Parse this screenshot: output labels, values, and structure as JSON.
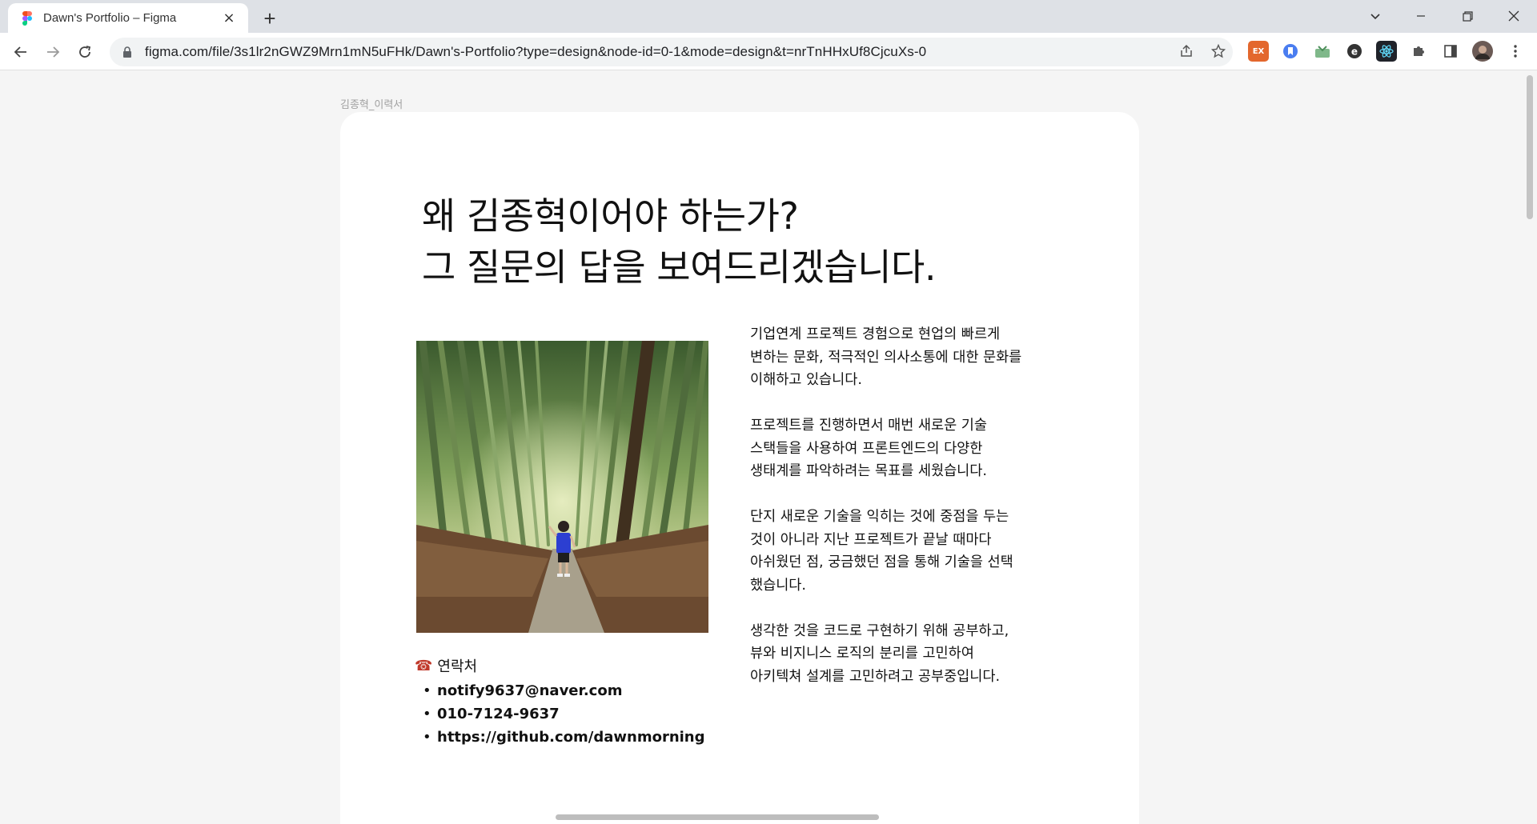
{
  "browser": {
    "tab_title": "Dawn's Portfolio – Figma",
    "url": "figma.com/file/3s1lr2nGWZ9Mrn1mN5uFHk/Dawn's-Portfolio?type=design&node-id=0-1&mode=design&t=nrTnHHxUf8CjcuXs-0",
    "new_tab_label": "+",
    "close_tab_label": "×",
    "extensions": [
      "ex-extension-icon",
      "bookmark-extension-icon",
      "inbox-extension-icon",
      "g-extension-icon",
      "react-devtools-icon",
      "puzzle-icon",
      "sidepanel-icon",
      "profile-avatar"
    ]
  },
  "canvas": {
    "frame_label": "김종혁_이력서",
    "headline_line1": "왜 김종혁이어야 하는가?",
    "headline_line2": "그 질문의 답을 보여드리겠습니다.",
    "contact_title": "연락처",
    "contact_icon": "☎",
    "contacts": [
      "notify9637@naver.com",
      "010-7124-9637",
      "https://github.com/dawnmorning"
    ],
    "paragraphs": [
      "기업연계 프로젝트 경험으로 현업의 빠르게\n변하는 문화, 적극적인 의사소통에 대한 문화를\n이해하고 있습니다.",
      "프로젝트를 진행하면서 매번 새로운 기술\n스택들을 사용하여 프론트엔드의 다양한\n생태계를 파악하려는 목표를 세웠습니다.",
      "단지 새로운 기술을 익히는 것에 중점을 두는\n것이 아니라 지난 프로젝트가 끝날 때마다\n아쉬웠던 점, 궁금했던 점을 통해 기술을 선택\n했습니다.",
      "생각한 것을 코드로 구현하기 위해 공부하고,\n뷰와 비지니스 로직의 분리를 고민하여\n아키텍쳐 설계를 고민하려고 공부중입니다."
    ]
  },
  "colors": {
    "chrome_bg": "#dee1e6",
    "canvas_bg": "#f5f5f5",
    "frame_bg": "#ffffff",
    "text": "#111111"
  }
}
